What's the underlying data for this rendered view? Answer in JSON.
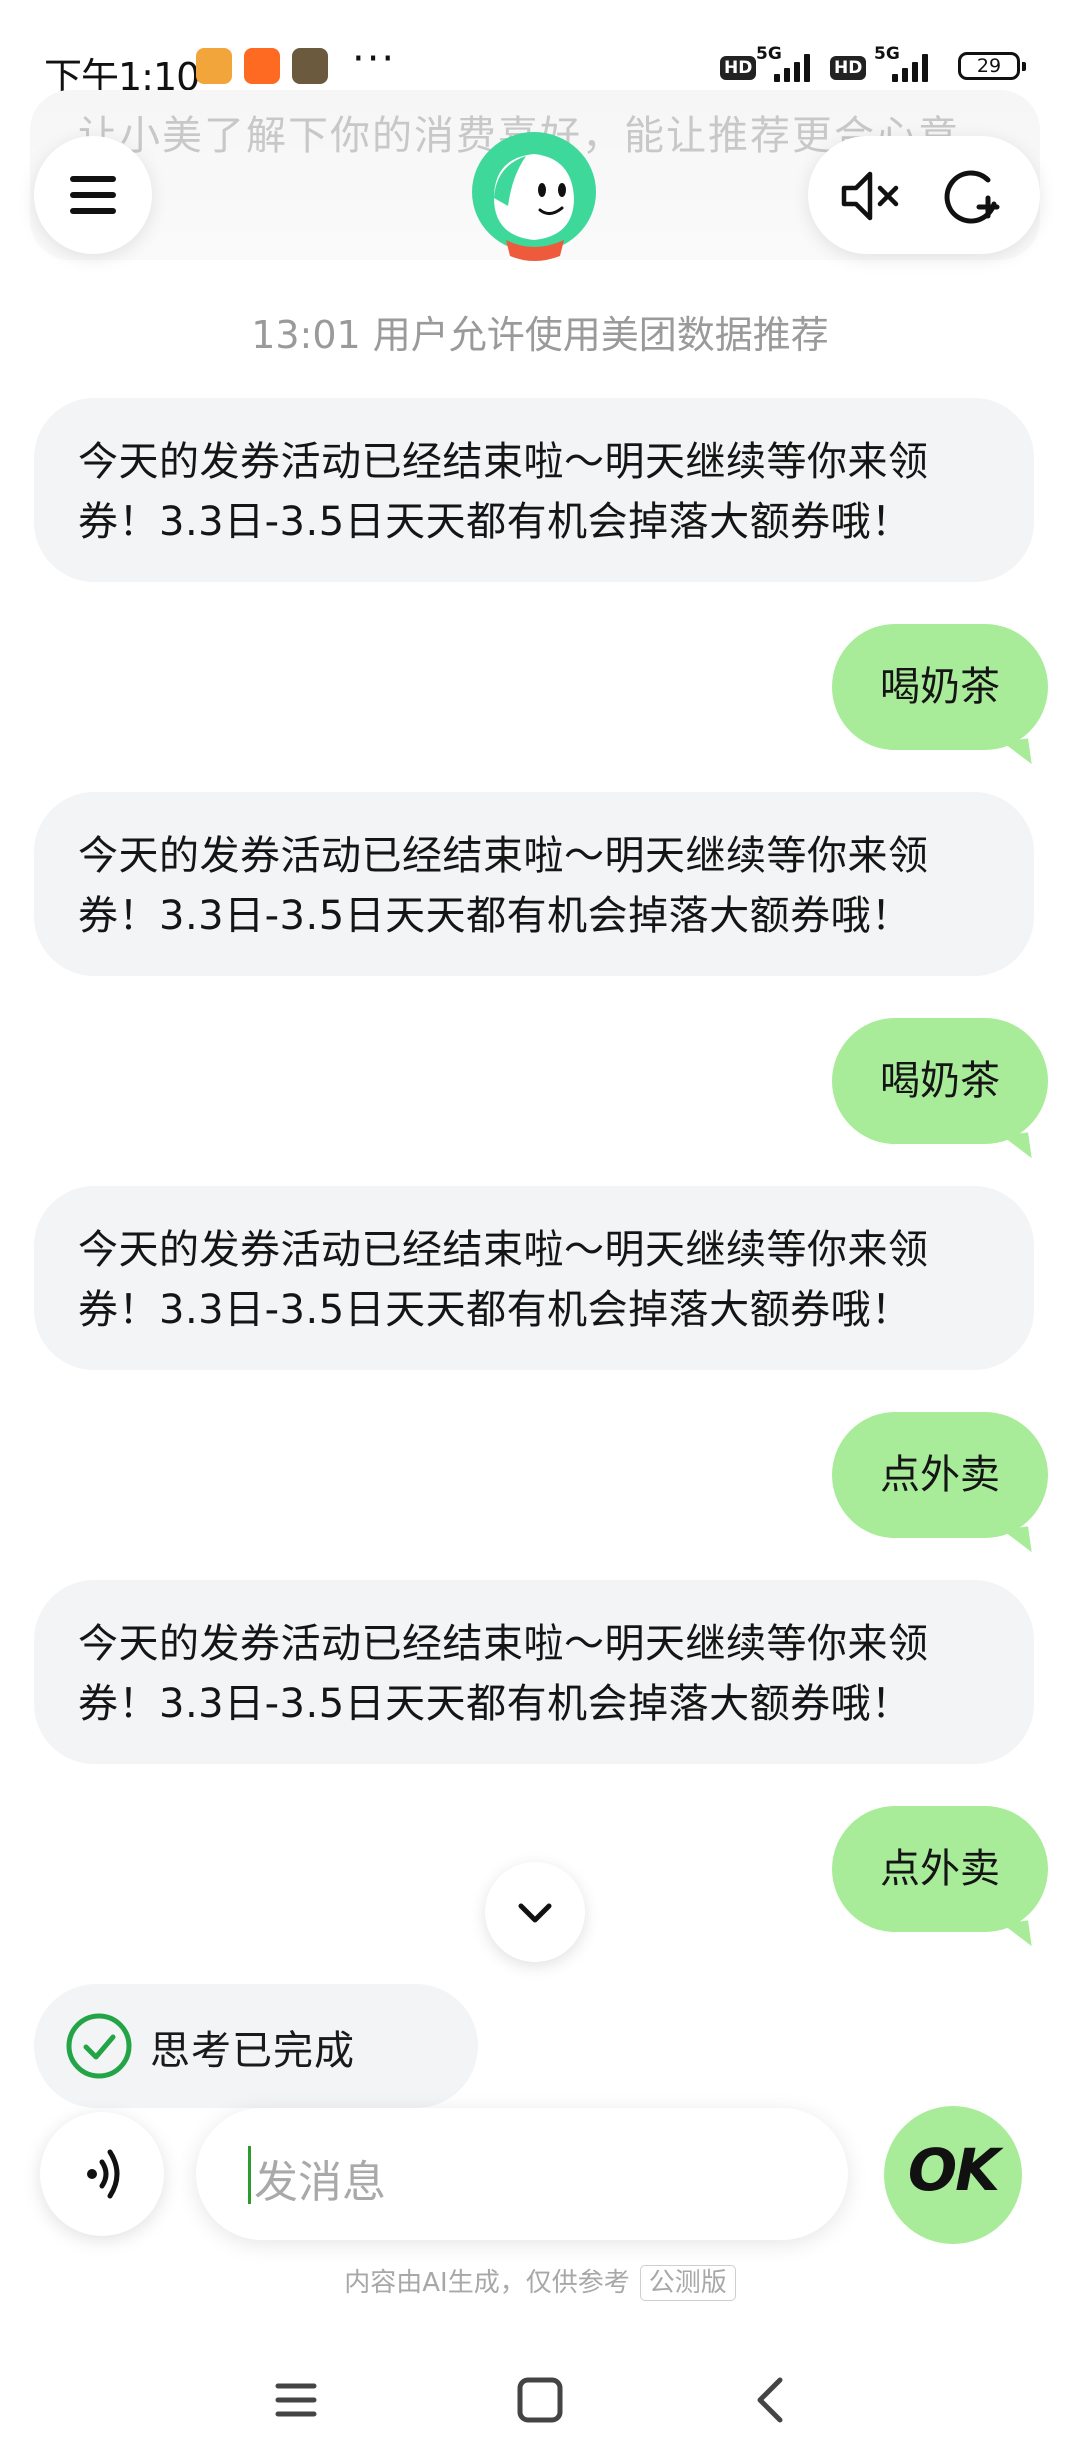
{
  "status_bar": {
    "time": "下午1:10",
    "network_1": "5G",
    "network_2": "5G",
    "hd_1": "HD",
    "hd_2": "HD",
    "battery": "29",
    "more_dots": "···"
  },
  "header": {
    "banner_text": "让小美了解下你的消费喜好，能让推荐更合心意"
  },
  "system_message": "13:01 用户允许使用美团数据推荐",
  "messages": [
    {
      "role": "assistant",
      "line1": "今天的发券活动已经结束啦～明天继续等你来领",
      "line2": "券！3.3日-3.5日天天都有机会掉落大额券哦！"
    },
    {
      "role": "user",
      "text": "喝奶茶"
    },
    {
      "role": "assistant",
      "line1": "今天的发券活动已经结束啦～明天继续等你来领",
      "line2": "券！3.3日-3.5日天天都有机会掉落大额券哦！"
    },
    {
      "role": "user",
      "text": "喝奶茶"
    },
    {
      "role": "assistant",
      "line1": "今天的发券活动已经结束啦～明天继续等你来领",
      "line2": "券！3.3日-3.5日天天都有机会掉落大额券哦！"
    },
    {
      "role": "user",
      "text": "点外卖"
    },
    {
      "role": "assistant",
      "line1": "今天的发券活动已经结束啦～明天继续等你来领",
      "line2": "券！3.3日-3.5日天天都有机会掉落大额券哦！"
    },
    {
      "role": "user",
      "text": "点外卖"
    }
  ],
  "thinking_status": "思考已完成",
  "composer": {
    "placeholder": "发消息",
    "send_label": "OK"
  },
  "footer": {
    "disclaimer": "内容由AI生成，仅供参考",
    "badge": "公测版"
  },
  "colors": {
    "user_bubble": "#a8ec9a",
    "assistant_bubble": "#f3f4f5",
    "check_green": "#23a447",
    "mascot_green": "#3ed89a"
  },
  "icons": {
    "menu": "menu-icon",
    "mute": "speaker-mute-icon",
    "new_chat": "new-chat-icon",
    "scroll": "chevron-down-icon",
    "voice": "voice-wave-icon",
    "check": "check-circle-icon"
  }
}
